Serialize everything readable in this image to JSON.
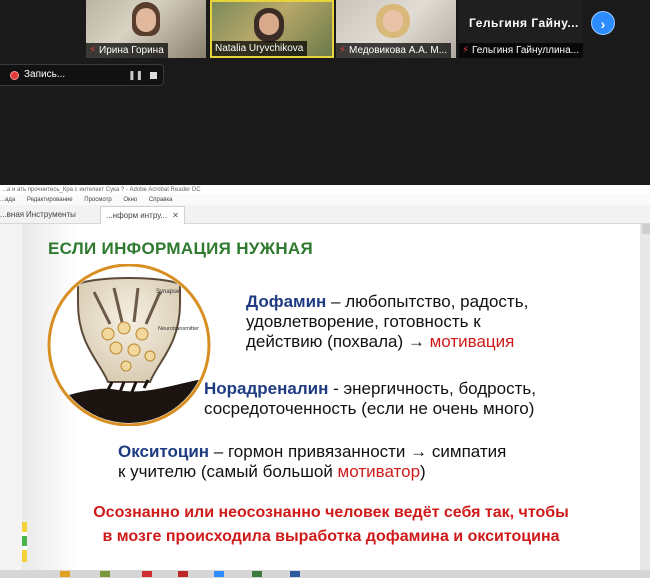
{
  "participants": [
    {
      "name": "Ирина Горина",
      "muted": true
    },
    {
      "name": "Natalia Uryvchikova",
      "muted": false
    },
    {
      "name": "Медовикова А.А. М...",
      "muted": true
    },
    {
      "name": "Гельгиня Гайнуллина...",
      "muted": true
    }
  ],
  "name_tile": {
    "big_name": "Гельгиня  Гайну..."
  },
  "recording": {
    "label": "Запись..."
  },
  "acrobat": {
    "title": "...а и ать прочнитесь_Кра с интелект Сука ? - Adobe Acrobat Reader DC",
    "menu": [
      "...ада",
      "Редактирование",
      "Просмотр",
      "Окно",
      "Справка"
    ],
    "tabs": [
      "...вная",
      "Инструменты",
      "...нформ интру..."
    ]
  },
  "slide": {
    "heading": "ЕСЛИ ИНФОРМАЦИЯ НУЖНАЯ",
    "synapse_label": "Synapse",
    "neuro_label": "Neurotransmitter",
    "dopamine_term": "Дофамин",
    "dopamine_line1": " – любопытство, радость,",
    "dopamine_line2": "удовлетворение, готовность к",
    "dopamine_line3": "действию (похвала) → ",
    "dopamine_result": "мотивация",
    "nor_term": "Норадреналин",
    "nor_line1": " - энергичность,  бодрость,",
    "nor_line2": "сосредоточенность (если не очень много)",
    "oxy_term": "Окситоцин",
    "oxy_line1": " – гормон привязанности  → симпатия",
    "oxy_line2": "к учителю (самый большой ",
    "oxy_result": "мотиватор",
    "oxy_close": ")",
    "bottom_line1": "Осознанно или неосознанно человек ведёт себя так, чтобы",
    "bottom_line2": "в мозге происходила выработка дофамина и окситоцина"
  },
  "colors": {
    "heading": "#2e7a2e",
    "term": "#1f3c82",
    "accent_red": "#d01a1a",
    "zoom_blue": "#2d8cff"
  }
}
